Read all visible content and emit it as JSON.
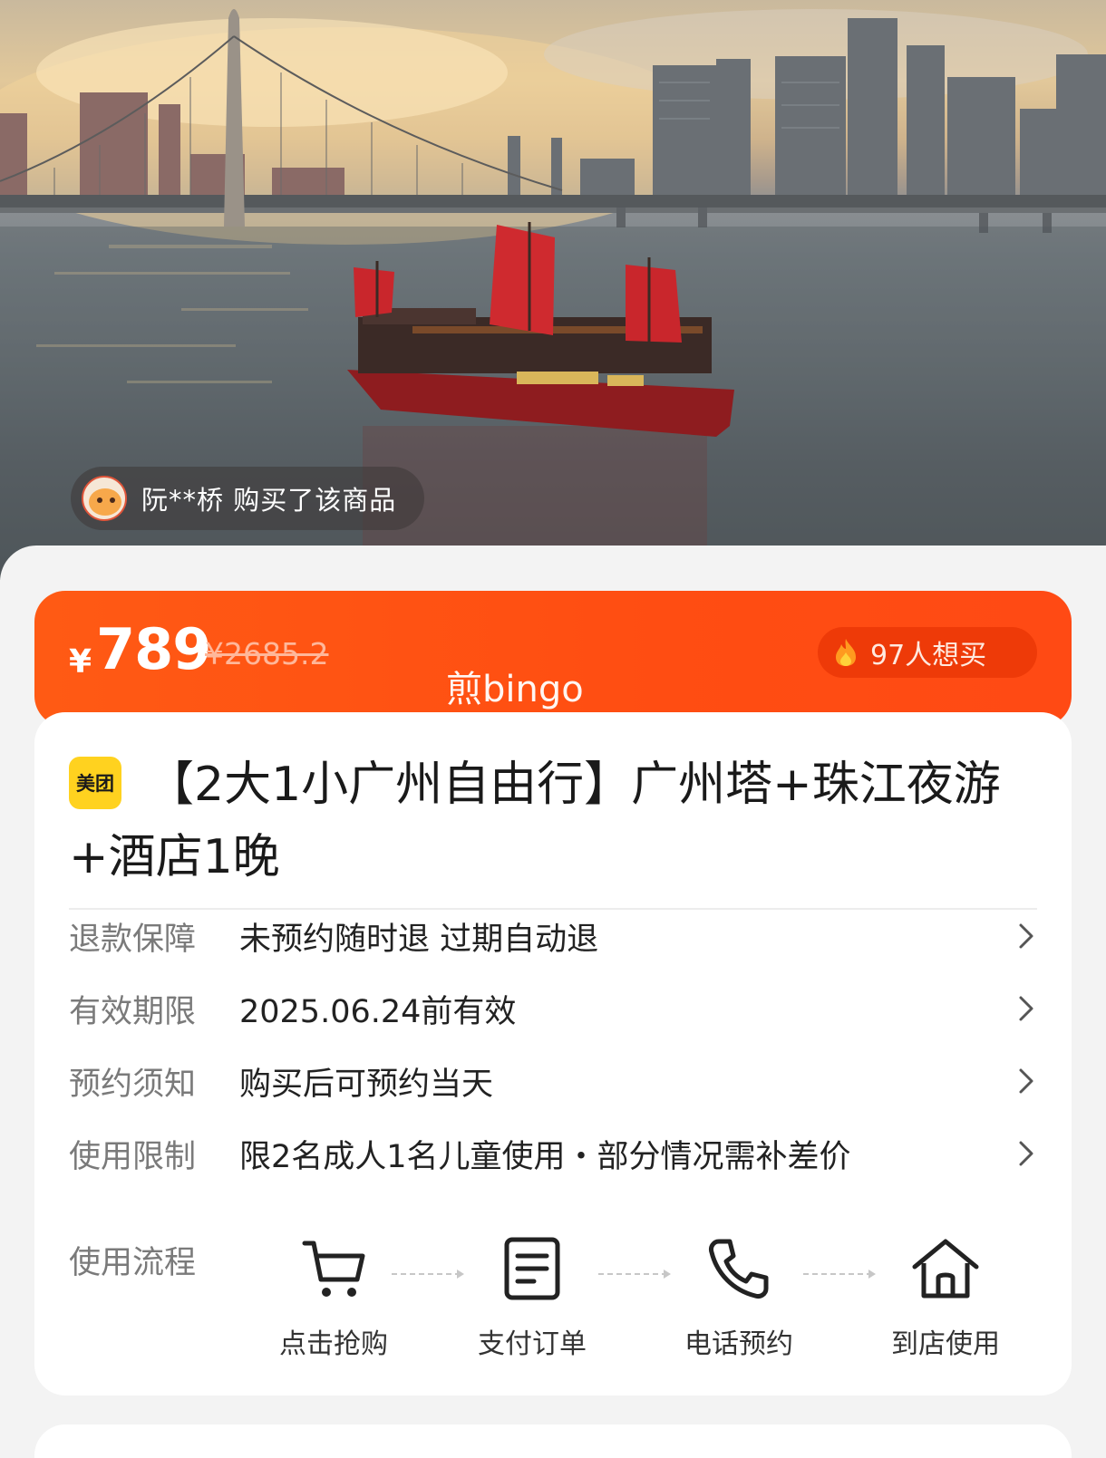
{
  "hero": {
    "buyer_notice": "阮**桥 购买了该商品"
  },
  "price": {
    "currency": "¥",
    "current": "789",
    "original": "¥2685.2",
    "want_count": "97人想买",
    "watermark": "煎bingo"
  },
  "product": {
    "brand_badge": "美团",
    "title": "【2大1小广州自由行】广州塔+珠江夜游+酒店1晚"
  },
  "info_rows": [
    {
      "label": "退款保障",
      "value": "未预约随时退 过期自动退"
    },
    {
      "label": "有效期限",
      "value": "2025.06.24前有效"
    },
    {
      "label": "预约须知",
      "value": "购买后可预约当天"
    },
    {
      "label": "使用限制",
      "value": "限2名成人1名儿童使用・部分情况需补差价"
    }
  ],
  "flow": {
    "label": "使用流程",
    "steps": [
      {
        "text": "点击抢购",
        "icon": "cart-icon"
      },
      {
        "text": "支付订单",
        "icon": "order-document-icon"
      },
      {
        "text": "电话预约",
        "icon": "phone-icon"
      },
      {
        "text": "到店使用",
        "icon": "home-icon"
      }
    ]
  },
  "colors": {
    "accent": "#ff5a14",
    "brand_yellow": "#ffd21f"
  }
}
